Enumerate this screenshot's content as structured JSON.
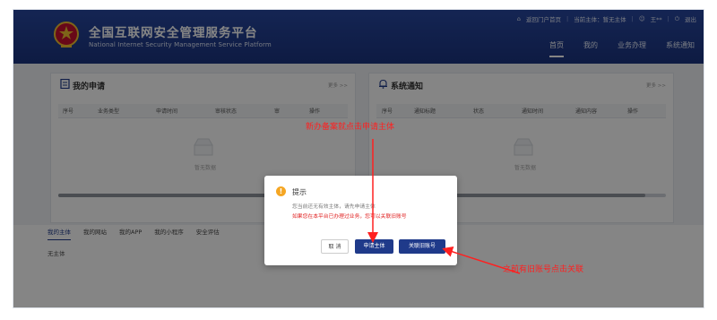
{
  "header": {
    "title": "全国互联网安全管理服务平台",
    "subtitle": "National Internet Security Management Service Platform",
    "topbar": {
      "home_link": "返回门户首页",
      "subject": "当前主体：暂无主体",
      "user": "王**",
      "logout": "退出"
    },
    "nav": [
      "首页",
      "我的",
      "业务办理",
      "系统通知"
    ]
  },
  "panels": {
    "left": {
      "title": "我的申请",
      "more": "更多 >>",
      "columns": [
        "序号",
        "业务类型",
        "申请时间",
        "审核状态",
        "审",
        "操作"
      ],
      "empty": "暂无数据"
    },
    "right": {
      "title": "系统通知",
      "more": "更多 >>",
      "columns": [
        "序号",
        "通知标题",
        "状态",
        "通知时间",
        "通知内容",
        "操作"
      ],
      "empty": "暂无数据"
    }
  },
  "bottom": {
    "tabs": [
      "我的主体",
      "我的网站",
      "我的APP",
      "我的小程序",
      "安全评估"
    ],
    "content": "无主体"
  },
  "dialog": {
    "icon": "warning-icon",
    "title": "提示",
    "message": "您当前还无有效主体，请先申请主体",
    "note": "如果您在本平台已办理过业务，您可以关联旧账号",
    "cancel": "取 消",
    "apply": "申请主体",
    "link": "关联旧账号"
  },
  "annotations": {
    "top": "新办备案就点击申请主体",
    "bottom": "之前有旧账号点击关联"
  },
  "colors": {
    "brand": "#1f3a8a",
    "annotation": "#ff2020",
    "warning": "#f5a623"
  }
}
